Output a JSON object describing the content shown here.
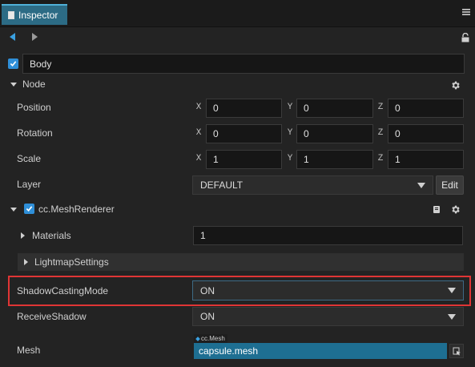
{
  "tab": {
    "title": "Inspector"
  },
  "header": {
    "node_name": "Body"
  },
  "node_section": {
    "title": "Node"
  },
  "transform": {
    "position": {
      "label": "Position",
      "x": "0",
      "y": "0",
      "z": "0"
    },
    "rotation": {
      "label": "Rotation",
      "x": "0",
      "y": "0",
      "z": "0"
    },
    "scale": {
      "label": "Scale",
      "x": "1",
      "y": "1",
      "z": "1"
    },
    "axes": {
      "x": "X",
      "y": "Y",
      "z": "Z"
    }
  },
  "layer": {
    "label": "Layer",
    "value": "DEFAULT",
    "edit_label": "Edit"
  },
  "component": {
    "title": "cc.MeshRenderer",
    "materials": {
      "label": "Materials",
      "value": "1"
    },
    "lightmap": {
      "label": "LightmapSettings"
    },
    "shadow_casting": {
      "label": "ShadowCastingMode",
      "value": "ON"
    },
    "receive_shadow": {
      "label": "ReceiveShadow",
      "value": "ON"
    },
    "mesh": {
      "label": "Mesh",
      "type_tag": "cc.Mesh",
      "value": "capsule.mesh"
    }
  },
  "colors": {
    "accent": "#2f8fd8",
    "highlight": "#e03535",
    "tab": "#2c6b85",
    "mesh_field": "#1e6f92"
  },
  "icons": [
    "inspector-icon",
    "back-arrow-icon",
    "forward-arrow-icon",
    "lock-icon",
    "gear-icon",
    "book-icon",
    "asset-pick-icon",
    "menu-icon"
  ]
}
